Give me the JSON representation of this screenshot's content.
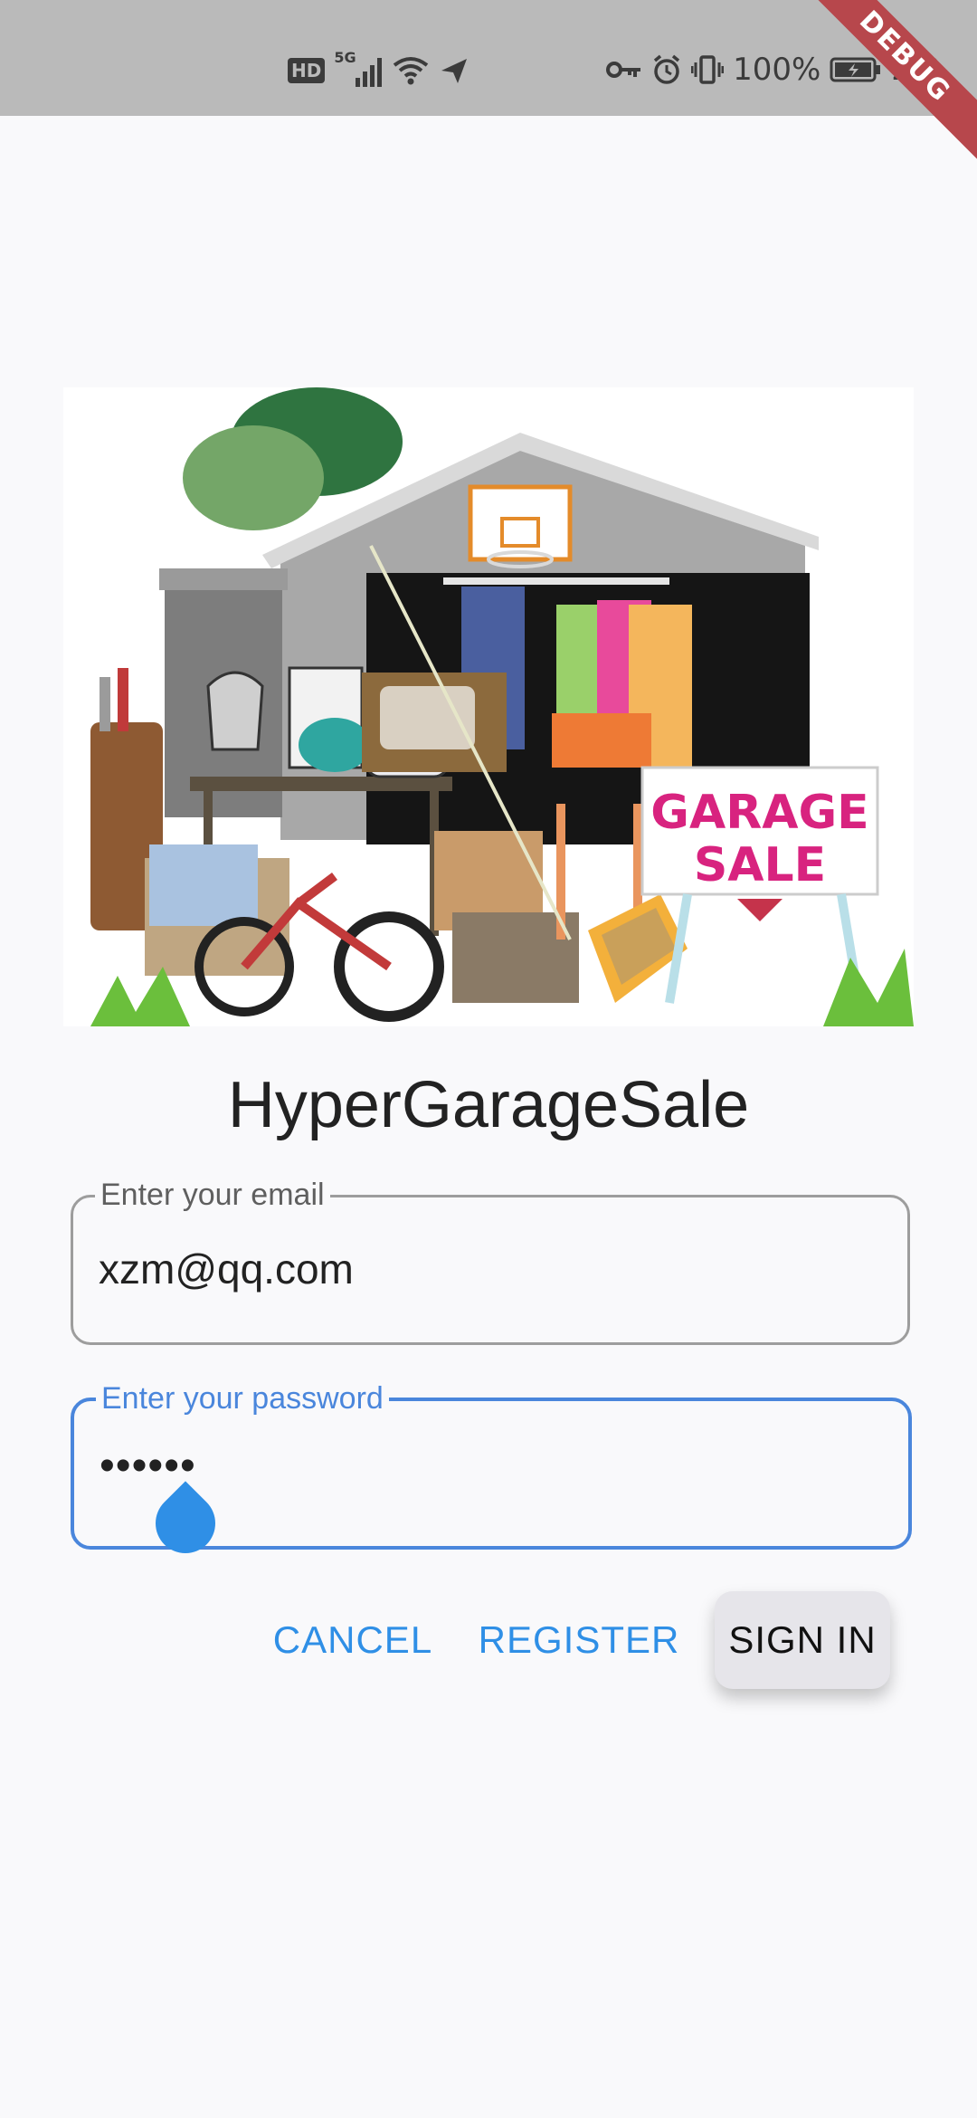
{
  "status_bar": {
    "network_hd": "HD",
    "network_5g": "5G",
    "battery_percent": "100%",
    "time": "2:2"
  },
  "debug_banner": "DEBUG",
  "hero": {
    "sign_text_line1": "GARAGE",
    "sign_text_line2": "SALE"
  },
  "app": {
    "title": "HyperGarageSale"
  },
  "email": {
    "label": "Enter your email",
    "value": "xzm@qq.com"
  },
  "password": {
    "label": "Enter your password",
    "value": "••••••"
  },
  "buttons": {
    "cancel": "CANCEL",
    "register": "REGISTER",
    "sign_in": "SIGN IN"
  },
  "colors": {
    "accent": "#2f8fe6",
    "focus_border": "#4a86dc",
    "status_bar_bg": "#bababa",
    "debug_banner": "#b7474c",
    "sign_text": "#d8237f"
  }
}
